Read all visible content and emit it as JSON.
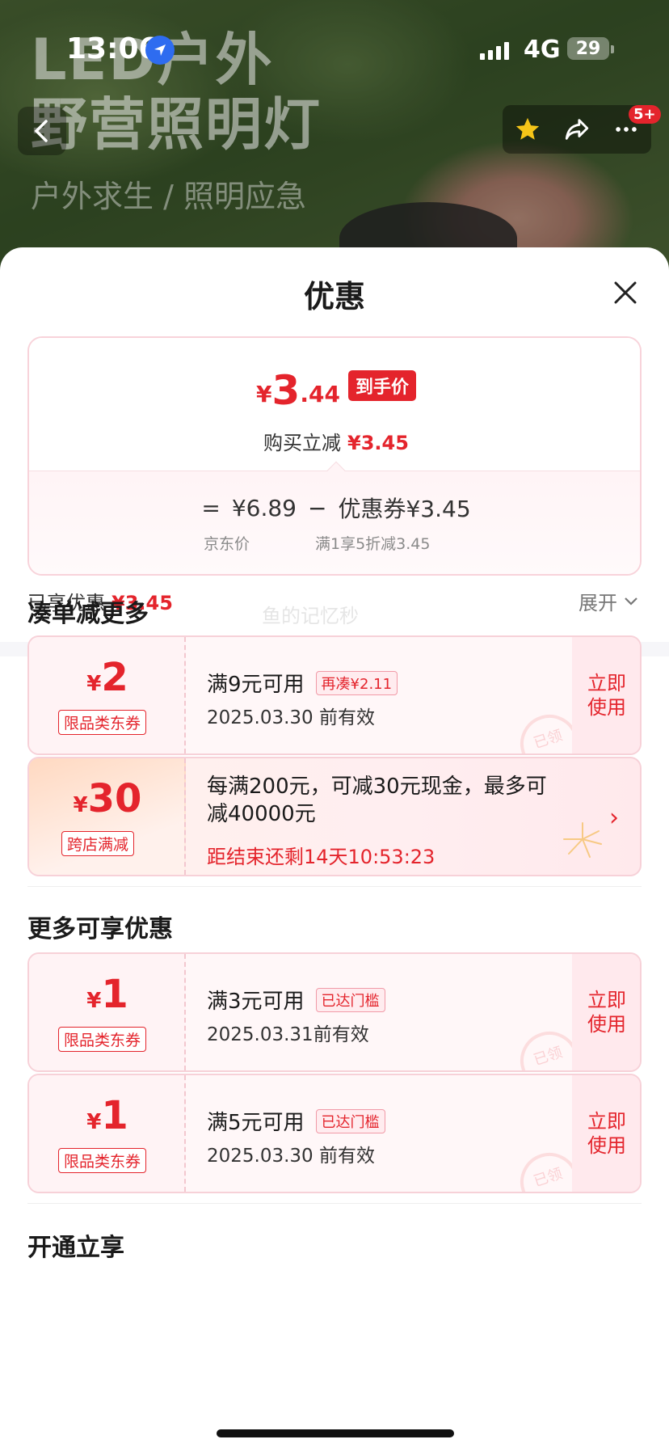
{
  "background": {
    "title_line1": "LED户外",
    "title_line2": "野营照明灯",
    "subtitle": "户外求生 / 照明应急"
  },
  "status_bar": {
    "time": "13:06",
    "network": "4G",
    "battery": "29"
  },
  "nav": {
    "back_icon": "chevron-left-icon",
    "favorite_icon": "star-icon",
    "share_icon": "share-icon",
    "more_icon": "more-icon",
    "more_badge": "5+"
  },
  "sheet": {
    "title": "优惠",
    "price": {
      "currency": "¥",
      "integer": "3",
      "decimal": ".44",
      "tag": "到手价",
      "reduce_label": "购买立减",
      "reduce_value": "¥3.45",
      "equals": "=",
      "base_price": "¥6.89",
      "minus": "−",
      "coupon_label": "优惠券¥3.45",
      "base_caption": "京东价",
      "coupon_caption": "满1享5折减3.45"
    },
    "enjoyed_label": "已享优惠",
    "enjoyed_value": "¥3.45",
    "expand_label": "展开",
    "section_more": "凑单减更多",
    "watermark": "鱼的记忆秒",
    "coupons_more": [
      {
        "currency": "¥",
        "amount": "2",
        "tag": "限品类东券",
        "condition": "满9元可用",
        "badge": "再凑¥2.11",
        "expiry": "2025.03.30 前有效",
        "use_label_1": "立即",
        "use_label_2": "使用",
        "stamp": "已领"
      }
    ],
    "promo": {
      "currency": "¥",
      "amount": "30",
      "tag": "跨店满减",
      "line1": "每满200元，可减30元现金，最多可",
      "line2": "减40000元",
      "countdown": "距结束还剩14天10:53:23"
    },
    "section_enjoy": "更多可享优惠",
    "coupons_enjoy": [
      {
        "currency": "¥",
        "amount": "1",
        "tag": "限品类东券",
        "condition": "满3元可用",
        "badge": "已达门槛",
        "expiry": "2025.03.31前有效",
        "use_label_1": "立即",
        "use_label_2": "使用",
        "stamp": "已领"
      },
      {
        "currency": "¥",
        "amount": "1",
        "tag": "限品类东券",
        "condition": "满5元可用",
        "badge": "已达门槛",
        "expiry": "2025.03.30 前有效",
        "use_label_1": "立即",
        "use_label_2": "使用",
        "stamp": "已领"
      }
    ],
    "section_open": "开通立享"
  },
  "colors": {
    "accent_red": "#e4242c",
    "coupon_border": "#f7d1d8",
    "coupon_bg": "#fff7f8"
  }
}
